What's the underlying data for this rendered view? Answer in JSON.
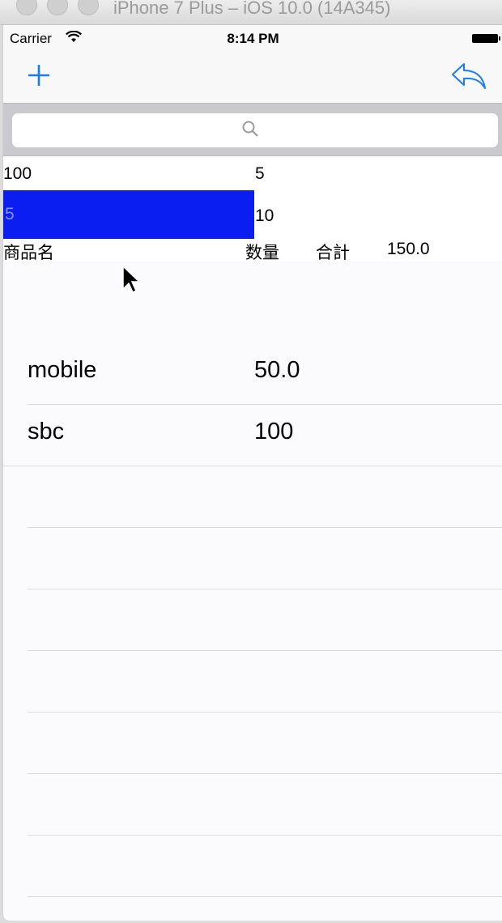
{
  "window": {
    "title": "iPhone 7 Plus – iOS 10.0 (14A345)"
  },
  "status_bar": {
    "carrier": "Carrier",
    "time": "8:14 PM"
  },
  "nav": {
    "add_icon": "plus-icon",
    "back_icon": "reply-arrow-icon"
  },
  "search": {
    "placeholder": "",
    "value": ""
  },
  "form": {
    "first_value": "100",
    "first_qty": "5",
    "price_value": "5",
    "second_qty": "10",
    "label_name": "商品名",
    "label_qty": "数量",
    "label_total": "合計",
    "total_value": "150.0"
  },
  "items": [
    {
      "name": "mobile",
      "value": "50.0"
    },
    {
      "name": "sbc",
      "value": "100"
    }
  ],
  "colors": {
    "tint": "#1a7cf5",
    "highlight": "#0a1ef2"
  }
}
